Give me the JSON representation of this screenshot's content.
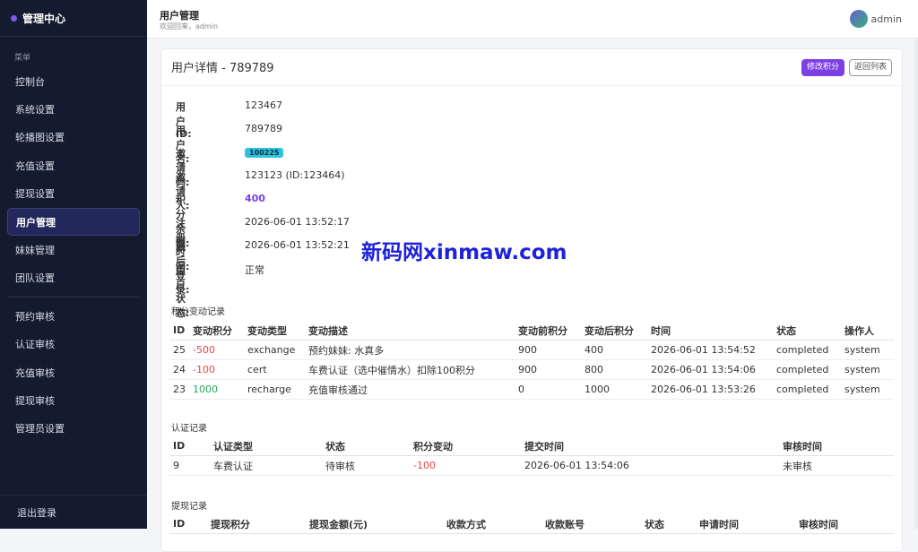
{
  "sidebar": {
    "brand": "管理中心",
    "section": "菜单",
    "items": [
      {
        "label": "控制台",
        "active": false
      },
      {
        "label": "系统设置",
        "active": false
      },
      {
        "label": "轮播图设置",
        "active": false
      },
      {
        "label": "充值设置",
        "active": false
      },
      {
        "label": "提现设置",
        "active": false
      },
      {
        "label": "用户管理",
        "active": true
      },
      {
        "label": "妹妹管理",
        "active": false
      },
      {
        "label": "团队设置",
        "active": false
      }
    ],
    "items2": [
      {
        "label": "预约审核"
      },
      {
        "label": "认证审核"
      },
      {
        "label": "充值审核"
      },
      {
        "label": "提现审核"
      },
      {
        "label": "管理员设置"
      }
    ],
    "logout": "退出登录"
  },
  "header": {
    "title": "用户管理",
    "subtitle": "欢迎回来，admin",
    "user": "admin"
  },
  "detail": {
    "title": "用户详情 - 789789",
    "edit_button": "修改积分",
    "back_button": "返回列表",
    "fields": {
      "user_id": {
        "label": "用户ID:",
        "value": "123467"
      },
      "username": {
        "label": "用户名:",
        "value": "789789"
      },
      "invite_code": {
        "label": "邀请码:",
        "value": "100225"
      },
      "inviter": {
        "label": "邀请人:",
        "value": "123123 (ID:123464)"
      },
      "balance": {
        "label": "积分余额:",
        "value": "400"
      },
      "reg_time": {
        "label": "注册时间:",
        "value": "2026-06-01 13:52:17"
      },
      "last_login": {
        "label": "最后登录:",
        "value": "2026-06-01 13:52:21"
      },
      "status": {
        "label": "用户状态:",
        "value": "正常"
      }
    }
  },
  "watermark": "新码网xinmaw.com",
  "points_log": {
    "title": "积分变动记录",
    "headers": [
      "ID",
      "变动积分",
      "变动类型",
      "变动描述",
      "变动前积分",
      "变动后积分",
      "时间",
      "状态",
      "操作人"
    ],
    "rows": [
      [
        "25",
        "-500",
        "exchange",
        "预约妹妹: 水真多",
        "900",
        "400",
        "2026-06-01 13:54:52",
        "completed",
        "system"
      ],
      [
        "24",
        "-100",
        "cert",
        "车费认证（选中催情水）扣除100积分",
        "900",
        "800",
        "2026-06-01 13:54:06",
        "completed",
        "system"
      ],
      [
        "23",
        "1000",
        "recharge",
        "充值审核通过",
        "0",
        "1000",
        "2026-06-01 13:53:26",
        "completed",
        "system"
      ]
    ]
  },
  "cert_log": {
    "title": "认证记录",
    "headers": [
      "ID",
      "认证类型",
      "状态",
      "积分变动",
      "提交时间",
      "审核时间"
    ],
    "rows": [
      [
        "9",
        "车费认证",
        "待审核",
        "-100",
        "2026-06-01 13:54:06",
        "未审核"
      ]
    ]
  },
  "withdraw_log": {
    "title": "提现记录",
    "headers": [
      "ID",
      "提现积分",
      "提现金额(元)",
      "收款方式",
      "收款账号",
      "状态",
      "申请时间",
      "审核时间"
    ]
  },
  "colors": {
    "accent": "#7b3fe4",
    "sidebar_bg": "#151b2e",
    "negative": "#e5484d",
    "positive": "#26a65b",
    "badge": "#2ec2e0"
  }
}
